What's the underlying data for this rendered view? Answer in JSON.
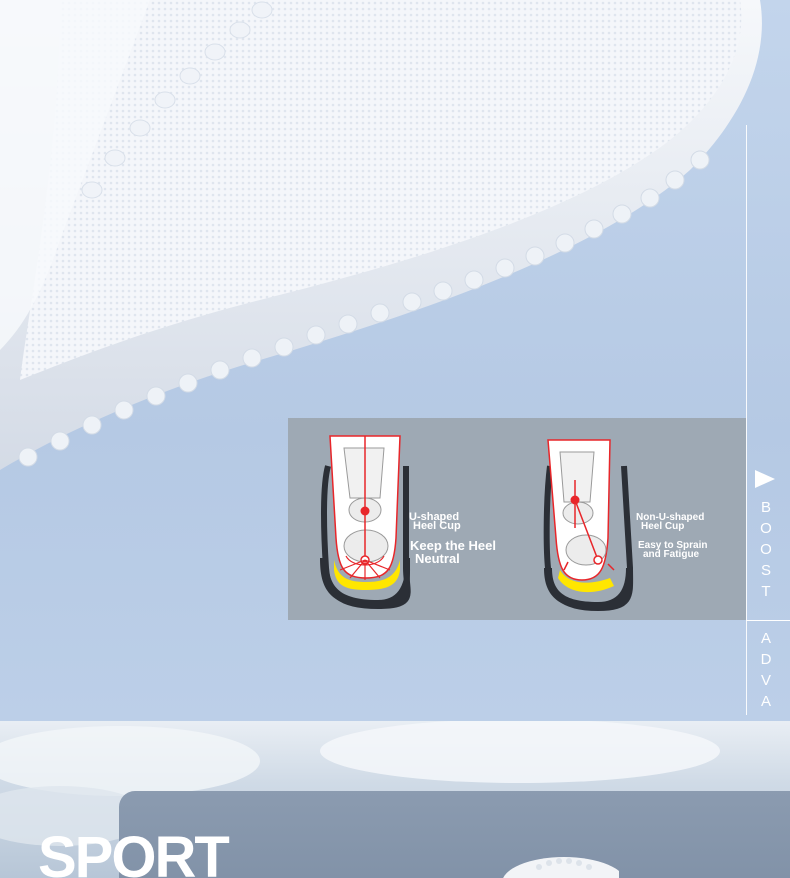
{
  "side": {
    "text_a": [
      "B",
      "O",
      "O",
      "S",
      "T"
    ],
    "text_b": [
      "A",
      "D",
      "V",
      "A"
    ]
  },
  "panel": {
    "left": {
      "title_line1": "U-shaped",
      "title_line2": "Heel Cup",
      "desc_line1": "Keep the Heel",
      "desc_line2": "Neutral"
    },
    "right": {
      "title_line1": "Non-U-shaped",
      "title_line2": "Heel Cup",
      "desc_line1": "Easy to Sprain",
      "desc_line2": "and Fatigue"
    }
  },
  "bottom": {
    "heading": "SPORT"
  },
  "colors": {
    "accent_red": "#e8262a",
    "heel_yellow": "#ffe600",
    "panel_bg": "#9ea9b4"
  }
}
